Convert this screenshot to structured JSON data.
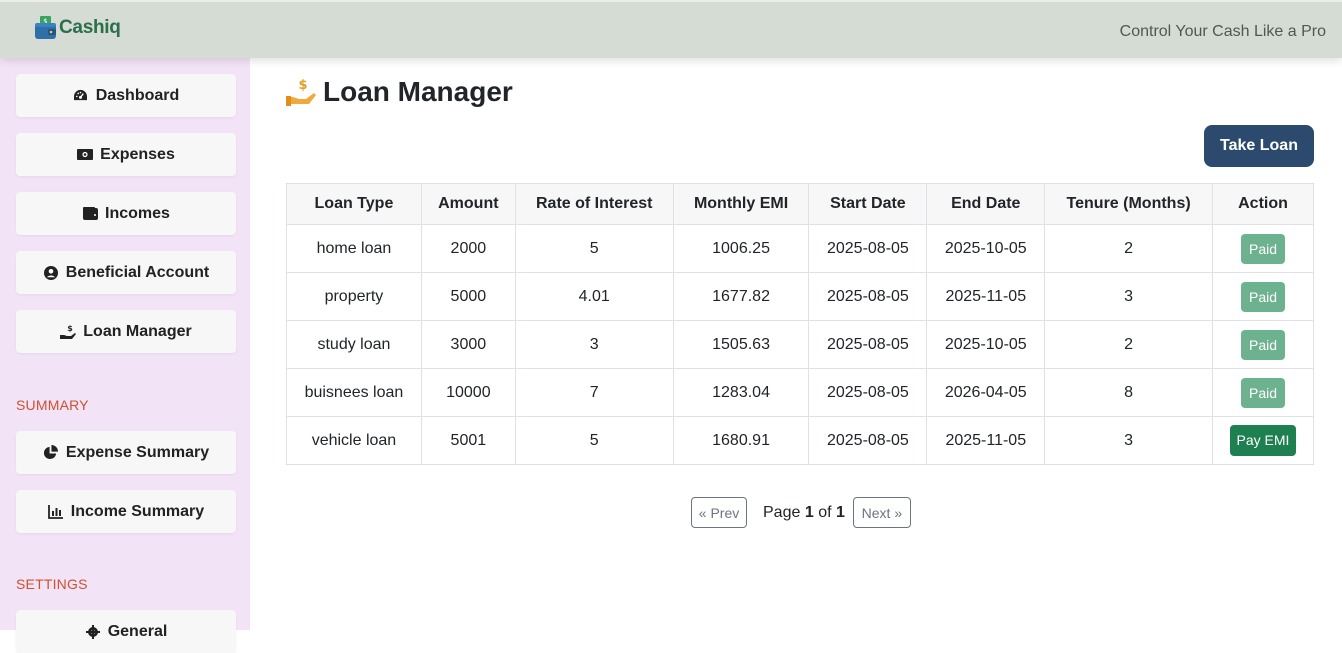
{
  "header": {
    "brand": "Cashiq",
    "tagline": "Control Your Cash Like a Pro"
  },
  "sidebar": {
    "items": [
      {
        "label": "Dashboard",
        "icon": "gauge-icon"
      },
      {
        "label": "Expenses",
        "icon": "money-bill-icon"
      },
      {
        "label": "Incomes",
        "icon": "wallet-icon"
      },
      {
        "label": "Beneficial Account",
        "icon": "user-circle-icon"
      },
      {
        "label": "Loan Manager",
        "icon": "hand-dollar-icon"
      }
    ],
    "summary_label": "SUMMARY",
    "summary_items": [
      {
        "label": "Expense Summary",
        "icon": "pie-chart-icon"
      },
      {
        "label": "Income Summary",
        "icon": "bar-chart-icon"
      }
    ],
    "settings_label": "SETTINGS",
    "settings_items": [
      {
        "label": "General",
        "icon": "gear-icon"
      }
    ]
  },
  "main": {
    "title": "Loan Manager",
    "take_loan_label": "Take Loan",
    "table": {
      "headers": [
        "Loan Type",
        "Amount",
        "Rate of Interest",
        "Monthly EMI",
        "Start Date",
        "End Date",
        "Tenure (Months)",
        "Action"
      ],
      "rows": [
        [
          "home loan",
          "2000",
          "5",
          "1006.25",
          "2025-08-05",
          "2025-10-05",
          "2",
          "Paid"
        ],
        [
          "property",
          "5000",
          "4.01",
          "1677.82",
          "2025-08-05",
          "2025-11-05",
          "3",
          "Paid"
        ],
        [
          "study loan",
          "3000",
          "3",
          "1505.63",
          "2025-08-05",
          "2025-10-05",
          "2",
          "Paid"
        ],
        [
          "buisnees loan",
          "10000",
          "7",
          "1283.04",
          "2025-08-05",
          "2026-04-05",
          "8",
          "Paid"
        ],
        [
          "vehicle loan",
          "5001",
          "5",
          "1680.91",
          "2025-08-05",
          "2025-11-05",
          "3",
          "Pay EMI"
        ]
      ]
    },
    "pagination": {
      "prev": "« Prev",
      "page_word": "Page",
      "current": "1",
      "of_word": "of",
      "total": "1",
      "next": "Next »"
    }
  },
  "colors": {
    "topbar": "#d5dcd3",
    "sidebar": "#f3e3f7",
    "brand": "#2b6f4d",
    "section_label": "#d0502f",
    "take_loan": "#2c4a6e",
    "paid": "#6db28f",
    "pay_emi": "#1e8050"
  }
}
